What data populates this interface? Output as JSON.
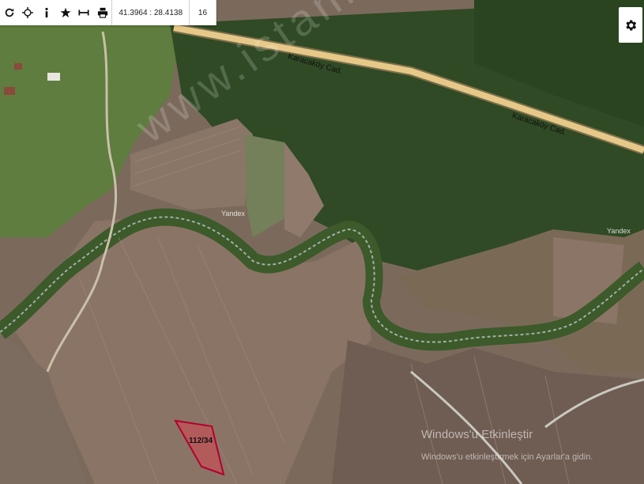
{
  "toolbar": {
    "icons": [
      "refresh-icon",
      "locate-icon",
      "info-icon",
      "star-icon",
      "measure-icon",
      "print-icon"
    ],
    "coordinates": "41.3964 : 28.4138",
    "zoom": "16"
  },
  "map": {
    "road_label_1": "Karacaköy Cad.",
    "road_label_2": "Karacaköy Cad.",
    "watermark": "www.istanbulharitaburs.net.tr",
    "yandex_1": "Yandex",
    "yandex_2": "Yandex",
    "parcel_label": "112/34",
    "parcel_color": "#b3002d"
  },
  "windows_notice": {
    "title": "Windows'u Etkinleştir",
    "subtitle": "Windows'u etkinleştirmek için Ayarlar'a gidin."
  }
}
